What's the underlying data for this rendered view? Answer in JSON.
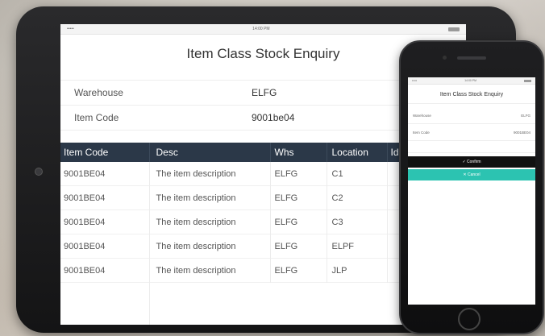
{
  "tablet": {
    "status": {
      "carrier": "•••••",
      "time": "14:00 PM"
    },
    "title": "Item Class Stock Enquiry",
    "form": [
      {
        "label": "Warehouse",
        "value": "ELFG"
      },
      {
        "label": "Item Code",
        "value": "9001be04"
      }
    ],
    "table": {
      "headers": [
        "Item Code",
        "Desc",
        "Whs",
        "Location",
        "Id"
      ],
      "rows": [
        [
          "9001BE04",
          "The item description",
          "ELFG",
          "C1"
        ],
        [
          "9001BE04",
          "The item description",
          "ELFG",
          "C2"
        ],
        [
          "9001BE04",
          "The item description",
          "ELFG",
          "C3"
        ],
        [
          "9001BE04",
          "The item description",
          "ELFG",
          "ELPF"
        ],
        [
          "9001BE04",
          "The item description",
          "ELFG",
          "JLP"
        ]
      ]
    }
  },
  "phone": {
    "status": {
      "carrier": "•••••",
      "time": "14:00 PM"
    },
    "title": "Item Class Stock Enquiry",
    "form": [
      {
        "label": "Warehouse",
        "value": "ELFG"
      },
      {
        "label": "Item Code",
        "value": "9001BE04"
      }
    ],
    "confirm_label": "✓ Confirm",
    "cancel_label": "✕ Cancel"
  },
  "colors": {
    "header_bg": "#2b3848",
    "confirm_bg": "#111111",
    "cancel_bg": "#2cc3b1"
  }
}
